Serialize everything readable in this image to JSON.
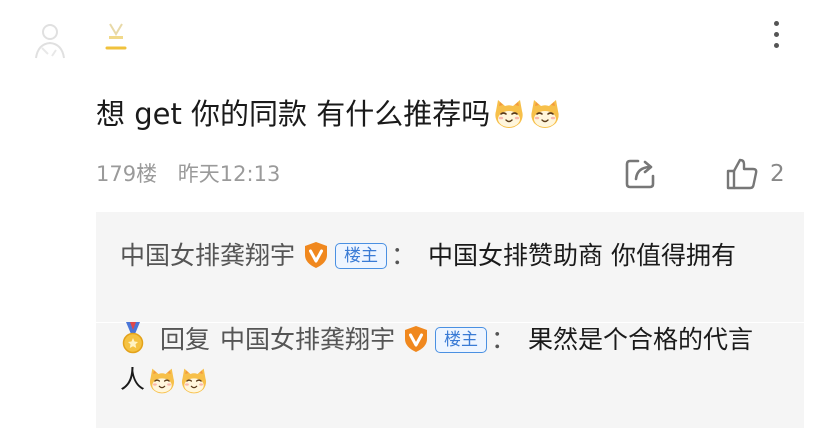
{
  "comment": {
    "text": "想 get 你的同款 有什么推荐吗",
    "emojis": [
      "cat-face-emoji",
      "cat-face-emoji"
    ]
  },
  "meta": {
    "floor": "179楼",
    "time": "昨天12:13"
  },
  "actions": {
    "like_count": "2",
    "icons": [
      "more-vertical-icon",
      "share-icon",
      "thumbs-up-icon"
    ]
  },
  "replies": [
    {
      "author": "中国女排龚翔宇",
      "owner_tag": "楼主",
      "colon": "：",
      "text": "中国女排赞助商 你值得拥有"
    },
    {
      "reply_word": "回复",
      "author": "中国女排龚翔宇",
      "owner_tag": "楼主",
      "colon": "：",
      "text": "果然是个合格的代言人",
      "emojis": [
        "cat-face-emoji",
        "cat-face-emoji"
      ]
    }
  ],
  "colors": {
    "vip_orange": "#f0881e",
    "tag_blue": "#3a7bd5",
    "meta_gray": "#9a9a9a",
    "emoji_yellow": "#f7c04a"
  }
}
